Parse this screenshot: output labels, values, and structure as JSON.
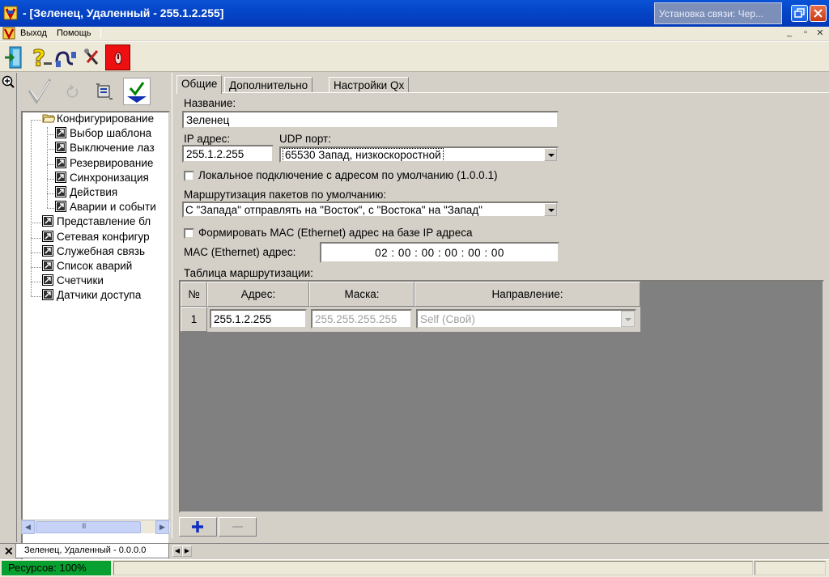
{
  "window": {
    "title": "- [Зеленец, Удаленный - 255.1.2.255]",
    "ghost_window_title": "Установка связи: Чер..."
  },
  "menu": {
    "items": [
      {
        "label": "Выход"
      },
      {
        "label": "Помощь"
      }
    ]
  },
  "toolbar": {
    "icons": [
      "exit-door-icon",
      "help-question-icon",
      "connect-plug-icon",
      "tools-icon",
      "stop-red-icon"
    ]
  },
  "left_pane": {
    "tools": [
      "apply-check-icon",
      "refresh-icon",
      "copy-config-icon",
      "confirm-download-icon"
    ],
    "tree": [
      {
        "label": "Конфигурирование",
        "level": 0,
        "icon": "folder-open-icon"
      },
      {
        "label": "Выбор шаблона",
        "level": 1,
        "icon": "shortcut-icon"
      },
      {
        "label": "Выключение лаз",
        "level": 1,
        "icon": "shortcut-icon"
      },
      {
        "label": "Резервирование",
        "level": 1,
        "icon": "shortcut-icon"
      },
      {
        "label": "Синхронизация",
        "level": 1,
        "icon": "shortcut-icon"
      },
      {
        "label": "Действия",
        "level": 1,
        "icon": "shortcut-icon"
      },
      {
        "label": "Аварии и событи",
        "level": 1,
        "icon": "shortcut-icon"
      },
      {
        "label": "Представление бл",
        "level": 0,
        "icon": "shortcut-icon"
      },
      {
        "label": "Сетевая конфигур",
        "level": 0,
        "icon": "shortcut-icon"
      },
      {
        "label": "Служебная связь",
        "level": 0,
        "icon": "shortcut-icon"
      },
      {
        "label": "Список аварий",
        "level": 0,
        "icon": "shortcut-icon"
      },
      {
        "label": "Счетчики",
        "level": 0,
        "icon": "shortcut-icon"
      },
      {
        "label": "Датчики доступа",
        "level": 0,
        "icon": "shortcut-icon"
      }
    ],
    "scroll_glyph": "III"
  },
  "tabs": [
    {
      "label": "Общие",
      "active": true
    },
    {
      "label": "Дополнительно",
      "active": false
    },
    {
      "label": "Настройки Qx",
      "active": false
    }
  ],
  "form": {
    "name_label": "Название:",
    "name_value": "Зеленец",
    "ip_label": "IP адрес:",
    "ip_value": "255.1.2.255",
    "udp_label": "UDP порт:",
    "udp_value": "65530 Запад, низкоскоростной",
    "local_conn_label": "Локальное подключение с адресом по умолчанию (1.0.0.1)",
    "local_conn_checked": false,
    "routing_default_label": "Маршрутизация пакетов по умолчанию:",
    "routing_default_value": "С \"Запада\" отправлять на \"Восток\", с \"Востока\" на \"Запад\"",
    "mac_form_label": "Формировать MAC (Ethernet) адрес на базе IP адреса",
    "mac_form_checked": false,
    "mac_label": "MAC (Ethernet) адрес:",
    "mac_value": "02 : 00 : 00 : 00 : 00 : 00",
    "table_label": "Таблица маршрутизации:"
  },
  "routing_table": {
    "columns": [
      "№",
      "Адрес:",
      "Маска:",
      "Направление:"
    ],
    "rows": [
      {
        "num": "1",
        "address": "255.1.2.255",
        "mask": "255.255.255.255",
        "direction": "Self (Свой)"
      }
    ],
    "add_button": "+",
    "remove_button": "—"
  },
  "doc_tabs": {
    "close": "✕",
    "items": [
      {
        "label": "Зеленец, Удаленный - 0.0.0.0"
      }
    ]
  },
  "status": {
    "resources": "Ресурсов: 100%",
    "resources_color": "#08a030"
  }
}
